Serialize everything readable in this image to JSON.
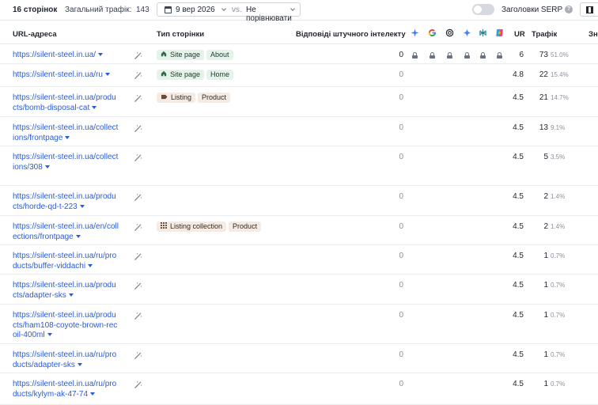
{
  "toolbar": {
    "count_label": "16 сторінок",
    "traffic_label": "Загальний трафік:",
    "traffic_value": "143",
    "date": "9 вер 2026",
    "vs": "vs.",
    "compare": "Не порівнювати",
    "serp_toggle_label": "Заголовки SERP",
    "serp_toggle_on": false,
    "help": "?"
  },
  "header": {
    "url": "URL-адреса",
    "page_type": "Тип сторінки",
    "ai": "Відповіді штучного інтелекту",
    "ur": "UR",
    "traffic": "Трафік",
    "next": "Зн"
  },
  "ai_engines": [
    "ai-overview-icon",
    "google-icon",
    "chatgpt-icon",
    "gemini-icon",
    "perplexity-icon",
    "copilot-icon"
  ],
  "colors": {
    "link": "#2a5bd7",
    "tag_green": "#e5f3eb",
    "tag_brown": "#f4ebe4"
  },
  "rows": [
    {
      "url_l1": "https://silent-steel.in.ua/",
      "url_l2": "",
      "url_l3": "",
      "type": "Site page",
      "type_style": "green",
      "type_icon": "home-icon",
      "sub": "About",
      "sub_style": "green",
      "ai": "0",
      "locked": true,
      "ur": "6",
      "traffic": "73",
      "pct": "51.0%"
    },
    {
      "url_l1": "https://silent-steel.in.ua/ru",
      "url_l2": "",
      "url_l3": "",
      "type": "Site page",
      "type_style": "green",
      "type_icon": "home-icon",
      "sub": "Home",
      "sub_style": "green",
      "ai": "0",
      "locked": false,
      "ur": "4.8",
      "traffic": "22",
      "pct": "15.4%"
    },
    {
      "url_l1": "https://silent-steel.in.ua/produ",
      "url_l2": "cts/bomb-disposal-cat",
      "url_l3": "",
      "type": "Listing",
      "type_style": "brown",
      "type_icon": "tag-icon",
      "sub": "Product",
      "sub_style": "brown",
      "ai": "0",
      "locked": false,
      "ur": "4.5",
      "traffic": "21",
      "pct": "14.7%"
    },
    {
      "url_l1": "https://silent-steel.in.ua/collect",
      "url_l2": "ions/frontpage",
      "url_l3": "",
      "type": "",
      "type_style": "",
      "type_icon": "",
      "sub": "",
      "sub_style": "",
      "ai": "0",
      "locked": false,
      "ur": "4.5",
      "traffic": "13",
      "pct": "9.1%"
    },
    {
      "url_l1": "https://silent-steel.in.ua/collect",
      "url_l2": "ions/308",
      "url_l3": "",
      "type": "",
      "type_style": "",
      "type_icon": "",
      "sub": "",
      "sub_style": "",
      "ai": "0",
      "locked": false,
      "ur": "4.5",
      "traffic": "5",
      "pct": "3.5%"
    },
    {
      "url_l1": "https://silent-steel.in.ua/produ",
      "url_l2": "cts/horde-qd-t-223",
      "url_l3": "",
      "type": "",
      "type_style": "",
      "type_icon": "",
      "sub": "",
      "sub_style": "",
      "ai": "0",
      "locked": false,
      "ur": "4.5",
      "traffic": "2",
      "pct": "1.4%"
    },
    {
      "url_l1": "https://silent-steel.in.ua/en/coll",
      "url_l2": "ections/frontpage",
      "url_l3": "",
      "type": "Listing collection",
      "type_style": "brown",
      "type_icon": "grid-icon",
      "sub": "Product",
      "sub_style": "brown",
      "ai": "0",
      "locked": false,
      "ur": "4.5",
      "traffic": "2",
      "pct": "1.4%"
    },
    {
      "url_l1": "https://silent-steel.in.ua/ru/pro",
      "url_l2": "ducts/buffer-viddachi",
      "url_l3": "",
      "type": "",
      "type_style": "",
      "type_icon": "",
      "sub": "",
      "sub_style": "",
      "ai": "0",
      "locked": false,
      "ur": "4.5",
      "traffic": "1",
      "pct": "0.7%"
    },
    {
      "url_l1": "https://silent-steel.in.ua/produ",
      "url_l2": "cts/adapter-sks",
      "url_l3": "",
      "type": "",
      "type_style": "",
      "type_icon": "",
      "sub": "",
      "sub_style": "",
      "ai": "0",
      "locked": false,
      "ur": "4.5",
      "traffic": "1",
      "pct": "0.7%"
    },
    {
      "url_l1": "https://silent-steel.in.ua/produ",
      "url_l2": "cts/ham108-coyote-brown-rec",
      "url_l3": "oil-400ml",
      "type": "",
      "type_style": "",
      "type_icon": "",
      "sub": "",
      "sub_style": "",
      "ai": "0",
      "locked": false,
      "ur": "4.5",
      "traffic": "1",
      "pct": "0.7%"
    },
    {
      "url_l1": "https://silent-steel.in.ua/ru/pro",
      "url_l2": "ducts/adapter-sks",
      "url_l3": "",
      "type": "",
      "type_style": "",
      "type_icon": "",
      "sub": "",
      "sub_style": "",
      "ai": "0",
      "locked": false,
      "ur": "4.5",
      "traffic": "1",
      "pct": "0.7%"
    },
    {
      "url_l1": "https://silent-steel.in.ua/ru/pro",
      "url_l2": "ducts/kylym-ak-47-74",
      "url_l3": "",
      "type": "",
      "type_style": "",
      "type_icon": "",
      "sub": "",
      "sub_style": "",
      "ai": "0",
      "locked": false,
      "ur": "4.5",
      "traffic": "1",
      "pct": "0.7%"
    }
  ]
}
